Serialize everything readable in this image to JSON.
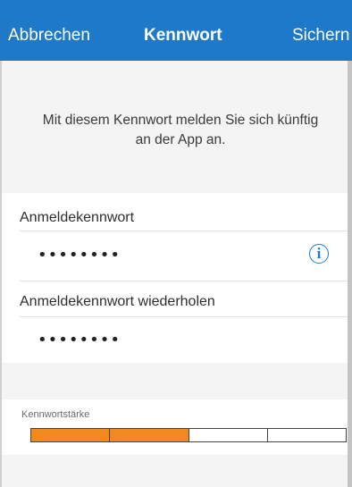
{
  "nav": {
    "cancel_label": "Abbrechen",
    "title": "Kennwort",
    "save_label": "Sichern"
  },
  "info": {
    "text_line1": "Mit diesem Kennwort melden Sie sich künftig",
    "text_line2": "an der App an."
  },
  "password": {
    "label": "Anmeldekennwort",
    "value": "••••••••",
    "info_icon": "info-icon"
  },
  "password_repeat": {
    "label": "Anmeldekennwort wiederholen",
    "value": "••••••••"
  },
  "strength": {
    "label": "Kennwortstärke",
    "level": 2,
    "max": 4
  },
  "colors": {
    "accent": "#1e7ac8",
    "strength_fill": "#f08a1e"
  }
}
